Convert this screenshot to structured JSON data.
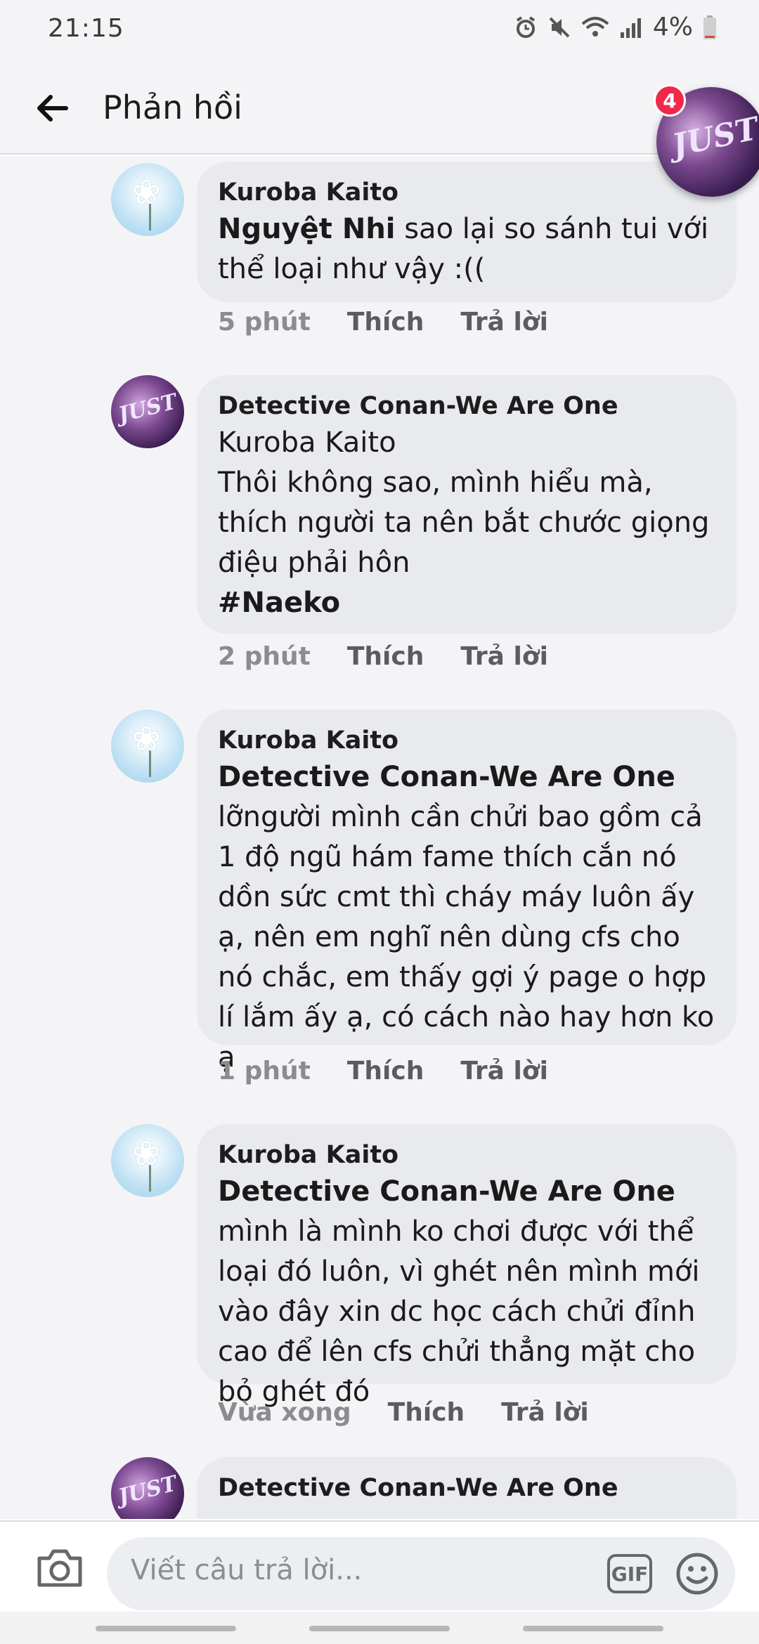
{
  "status_bar": {
    "time": "21:15",
    "battery": "4%"
  },
  "header": {
    "title": "Phản hồi",
    "chathead_badge": "4",
    "chathead_text": "JUST"
  },
  "comments": [
    {
      "author": "Kuroba Kaito",
      "mention": "Nguyệt Nhi",
      "text": " sao lại so sánh tui với thể loại như vậy :((",
      "time": "5 phút",
      "like": "Thích",
      "reply": "Trả lời",
      "avatar": "flower-avatar"
    },
    {
      "author": "Detective Conan-We Are One",
      "mention": "",
      "text": "Kuroba Kaito\nThôi không sao, mình hiểu mà, thích người ta nên bắt chước giọng điệu phải hôn",
      "hashtag": "#Naeko",
      "time": "2 phút",
      "like": "Thích",
      "reply": "Trả lời",
      "avatar": "anime-avatar",
      "avatar_text": "JUST"
    },
    {
      "author": "Kuroba Kaito",
      "mention": "Detective Conan-We Are One",
      "text": "lỡngười mình cần chửi bao gồm cả 1 độ ngũ hám fame thích cắn nó dồn sức cmt thì cháy máy luôn ấy ạ, nên em nghĩ nên dùng cfs cho nó chắc, em thấy gợi ý page o hợp lí lắm ấy ạ, có cách nào hay hơn ko ạ",
      "time": "1 phút",
      "like": "Thích",
      "reply": "Trả lời",
      "avatar": "flower-avatar"
    },
    {
      "author": "Kuroba Kaito",
      "mention": "Detective Conan-We Are One",
      "text": " mình là mình ko chơi được với thể loại đó luôn, vì ghét nên mình mới vào đây xin dc học cách chửi đỉnh cao để lên cfs chửi thẳng mặt cho bỏ ghét đó",
      "time": "Vừa xong",
      "like": "Thích",
      "reply": "Trả lời",
      "avatar": "flower-avatar"
    },
    {
      "author": "Detective Conan-We Are One",
      "avatar": "anime-avatar",
      "avatar_text": "JUST"
    }
  ],
  "composer": {
    "placeholder": "Viết câu trả lời...",
    "gif_label": "GIF"
  }
}
